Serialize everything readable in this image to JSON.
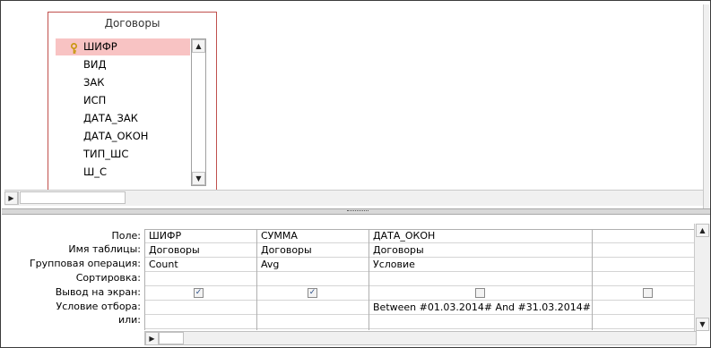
{
  "table_box": {
    "title": "Договоры",
    "fields": [
      "ШИФР",
      "ВИД",
      "ЗАК",
      "ИСП",
      "ДАТА_ЗАК",
      "ДАТА_ОКОН",
      "ТИП_ШС",
      "Ш_С"
    ],
    "selected_field": "ШИФР"
  },
  "grid": {
    "row_labels": [
      "Поле:",
      "Имя таблицы:",
      "Групповая операция:",
      "Сортировка:",
      "Вывод на экран:",
      "Условие отбора:",
      "или:"
    ],
    "columns": [
      {
        "field": "ШИФР",
        "table": "Договоры",
        "group_op": "Count",
        "sort": "",
        "show": true,
        "criteria": "",
        "or": ""
      },
      {
        "field": "СУММА",
        "table": "Договоры",
        "group_op": "Avg",
        "sort": "",
        "show": true,
        "criteria": "",
        "or": ""
      },
      {
        "field": "ДАТА_ОКОН",
        "table": "Договоры",
        "group_op": "Условие",
        "sort": "",
        "show": false,
        "criteria": "Between #01.03.2014# And #31.03.2014#",
        "or": ""
      },
      {
        "field": "",
        "table": "",
        "group_op": "",
        "sort": "",
        "show": false,
        "criteria": "",
        "or": ""
      }
    ]
  },
  "icons": {
    "key": "key-icon",
    "check": "✓"
  }
}
